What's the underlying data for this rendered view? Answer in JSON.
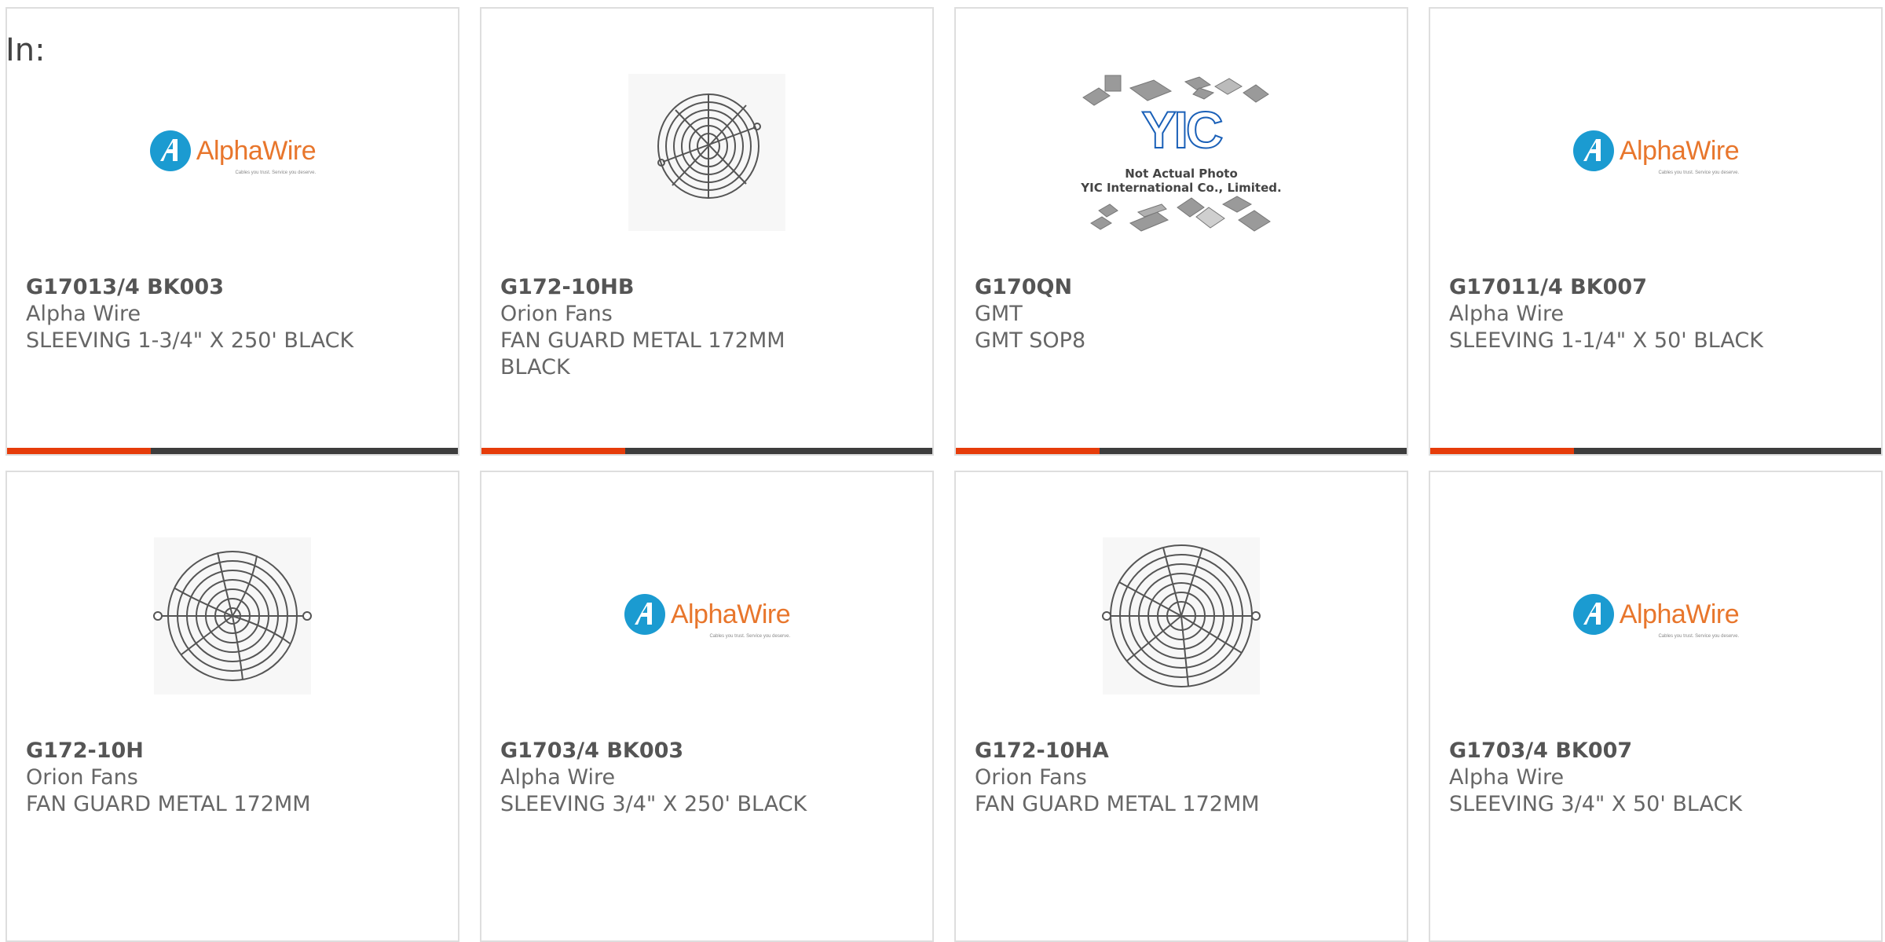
{
  "page": {
    "filter_label": "In:"
  },
  "products": [
    {
      "part_number": "G17013/4 BK003",
      "manufacturer": "Alpha Wire",
      "description": "SLEEVING 1-3/4\" X 250' BLACK",
      "image": "alphawire-logo",
      "show_accent": true
    },
    {
      "part_number": "G172-10HB",
      "manufacturer": "Orion Fans",
      "description": "FAN GUARD METAL 172MM BLACK",
      "image": "fan-guard-small",
      "show_accent": true
    },
    {
      "part_number": "G170QN",
      "manufacturer": "GMT",
      "description": "GMT SOP8",
      "image": "not-actual-photo",
      "show_accent": true
    },
    {
      "part_number": "G17011/4 BK007",
      "manufacturer": "Alpha Wire",
      "description": "SLEEVING 1-1/4\" X 50' BLACK",
      "image": "alphawire-logo",
      "show_accent": true
    },
    {
      "part_number": "G172-10H",
      "manufacturer": "Orion Fans",
      "description": "FAN GUARD METAL 172MM",
      "image": "fan-guard",
      "show_accent": false
    },
    {
      "part_number": "G1703/4 BK003",
      "manufacturer": "Alpha Wire",
      "description": "SLEEVING 3/4\" X 250' BLACK",
      "image": "alphawire-logo",
      "show_accent": false
    },
    {
      "part_number": "G172-10HA",
      "manufacturer": "Orion Fans",
      "description": "FAN GUARD METAL 172MM",
      "image": "fan-guard",
      "show_accent": false
    },
    {
      "part_number": "G1703/4 BK007",
      "manufacturer": "Alpha Wire",
      "description": "SLEEVING 3/4\" X 50' BLACK",
      "image": "alphawire-logo",
      "show_accent": false
    }
  ],
  "logos": {
    "alphawire": {
      "name": "AlphaWire",
      "tagline": "Cables you trust. Service you deserve."
    },
    "yic": {
      "brand": "YIC",
      "line1": "Not Actual Photo",
      "line2": "YIC International Co., Limited."
    }
  },
  "colors": {
    "accent": "#e63c0a",
    "bar": "#3d3d3d",
    "card_border": "#dedede",
    "alphawire_orange": "#e8762c",
    "alphawire_blue": "#1b9bd1"
  }
}
